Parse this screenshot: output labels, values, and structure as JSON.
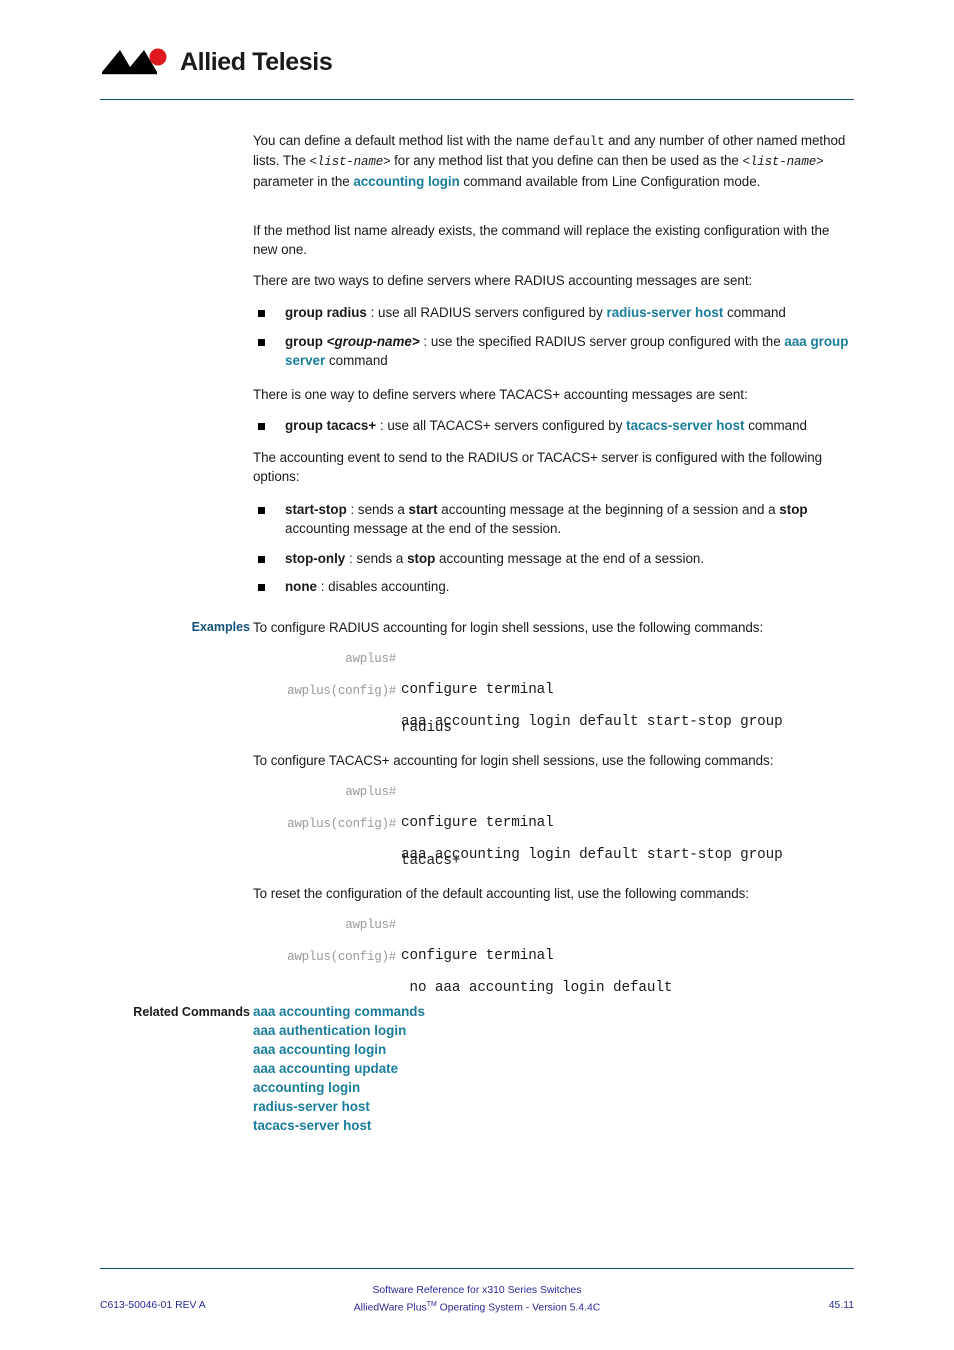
{
  "header": {
    "logo_text": "Allied Telesis",
    "logo_icon": "allied-telesis-chevron-logo"
  },
  "body": {
    "para1": {
      "seg1": "You can define a default method list with the name ",
      "mono1": "default",
      "seg2": " and any number of other named method lists. The ",
      "mono2": "<list-name>",
      "seg3": " for any method list that you define can then be used as the ",
      "mono3": "<list-name>",
      "seg4": " parameter in the ",
      "link1": "accounting login",
      "seg5": " command available from Line Configuration mode."
    },
    "para2": "If the method list name already exists, the command will replace the existing configuration with the new one.",
    "para3": "There are two ways to define servers where RADIUS accounting messages are sent:",
    "bullet_radius": {
      "term": "group radius",
      "seg1": " : use all RADIUS servers configured by ",
      "link": "radius-server host",
      "seg2": " command"
    },
    "bullet_group_name": {
      "term": "group ",
      "term_italic": "<group-name>",
      "seg1": " : use the specified RADIUS server group configured with the ",
      "link": "aaa group server",
      "seg2": " command"
    },
    "para4": "There is one way to define servers where TACACS+ accounting messages are sent:",
    "bullet_tacacs": {
      "term": "group tacacs+",
      "seg1": " : use all TACACS+ servers configured by ",
      "link": "tacacs-server host",
      "seg2": " command"
    },
    "para5": "The accounting event to send to the RADIUS or TACACS+ server is configured with the following options:",
    "bullet_start_stop": {
      "term": "start-stop",
      "seg1": " : sends a ",
      "bold1": "start",
      "seg2": " accounting message at the beginning of a session and a ",
      "bold2": "stop",
      "seg3": " accounting message at the end of the session."
    },
    "bullet_stop_only": {
      "term": "stop-only",
      "seg1": " : sends a ",
      "bold1": "stop",
      "seg2": " accounting message at the end of a session."
    },
    "bullet_none": {
      "term": "none",
      "seg1": " : disables accounting."
    }
  },
  "examples": {
    "label": "Examples",
    "intro1": "To configure RADIUS accounting for login shell sessions, use the following commands:",
    "block1": [
      {
        "prompt": "awplus#",
        "command": "configure terminal",
        "continuation": null
      },
      {
        "prompt": "awplus(config)#",
        "command": "aaa accounting login default start-stop group",
        "continuation": "radius"
      }
    ],
    "intro2": "To configure TACACS+ accounting for login shell sessions, use the following commands:",
    "block2": [
      {
        "prompt": "awplus#",
        "command": "configure terminal",
        "continuation": null
      },
      {
        "prompt": "awplus(config)#",
        "command": "aaa accounting login default start-stop group",
        "continuation": "tacacs+"
      }
    ],
    "intro3": "To reset the configuration of the default accounting list, use the following commands:",
    "block3": [
      {
        "prompt": "awplus#",
        "command": "configure terminal",
        "continuation": null
      },
      {
        "prompt": "awplus(config)#",
        "command": " no aaa accounting login default",
        "continuation": null
      }
    ]
  },
  "related": {
    "label": "Related Commands",
    "items": [
      "aaa accounting commands",
      "aaa authentication login",
      "aaa accounting login",
      "aaa accounting update",
      "accounting login",
      "radius-server host",
      "tacacs-server host"
    ]
  },
  "footer": {
    "center_line1": "Software Reference for x310 Series Switches",
    "center_line2_pre": "AlliedWare Plus",
    "center_line2_tm": "TM",
    "center_line2_post": " Operating System - Version 5.4.4C",
    "left": "C613-50046-01 REV A",
    "right": "45.11"
  },
  "colors": {
    "link_teal": "#1a7d9c",
    "label_navy": "#14527d",
    "rule_navy": "#0d5271",
    "footer_blue": "#2a2a96",
    "logo_red": "#e0181f",
    "prompt_grey": "#9a9a9a"
  }
}
